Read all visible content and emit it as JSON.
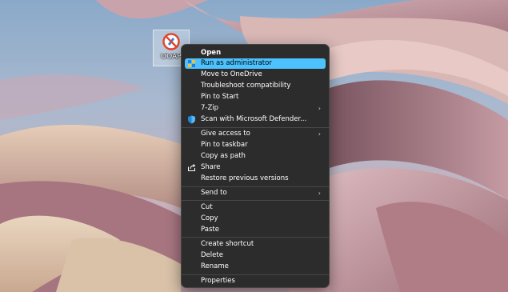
{
  "desktop": {
    "icon": {
      "label": "OOAP",
      "icon_name": "app-shortcut-icon"
    }
  },
  "context_menu": {
    "accent_color": "#4cc2ff",
    "items": [
      {
        "label": "Open",
        "bold": true,
        "icon": ""
      },
      {
        "label": "Run as administrator",
        "highlighted": true,
        "icon": "shield-uac-icon"
      },
      {
        "label": "Move to OneDrive",
        "icon": ""
      },
      {
        "label": "Troubleshoot compatibility",
        "icon": ""
      },
      {
        "label": "Pin to Start",
        "icon": ""
      },
      {
        "label": "7-Zip",
        "submenu": true,
        "icon": ""
      },
      {
        "label": "Scan with Microsoft Defender...",
        "icon": "defender-shield-icon"
      },
      {
        "label": "Give access to",
        "submenu": true,
        "icon": ""
      },
      {
        "label": "Pin to taskbar",
        "icon": ""
      },
      {
        "label": "Copy as path",
        "icon": ""
      },
      {
        "label": "Share",
        "icon": "share-icon"
      },
      {
        "label": "Restore previous versions",
        "icon": ""
      },
      {
        "label": "Send to",
        "submenu": true,
        "icon": ""
      },
      {
        "label": "Cut",
        "icon": ""
      },
      {
        "label": "Copy",
        "icon": ""
      },
      {
        "label": "Paste",
        "icon": ""
      },
      {
        "label": "Create shortcut",
        "icon": ""
      },
      {
        "label": "Delete",
        "icon": ""
      },
      {
        "label": "Rename",
        "icon": ""
      },
      {
        "label": "Properties",
        "icon": ""
      }
    ]
  }
}
